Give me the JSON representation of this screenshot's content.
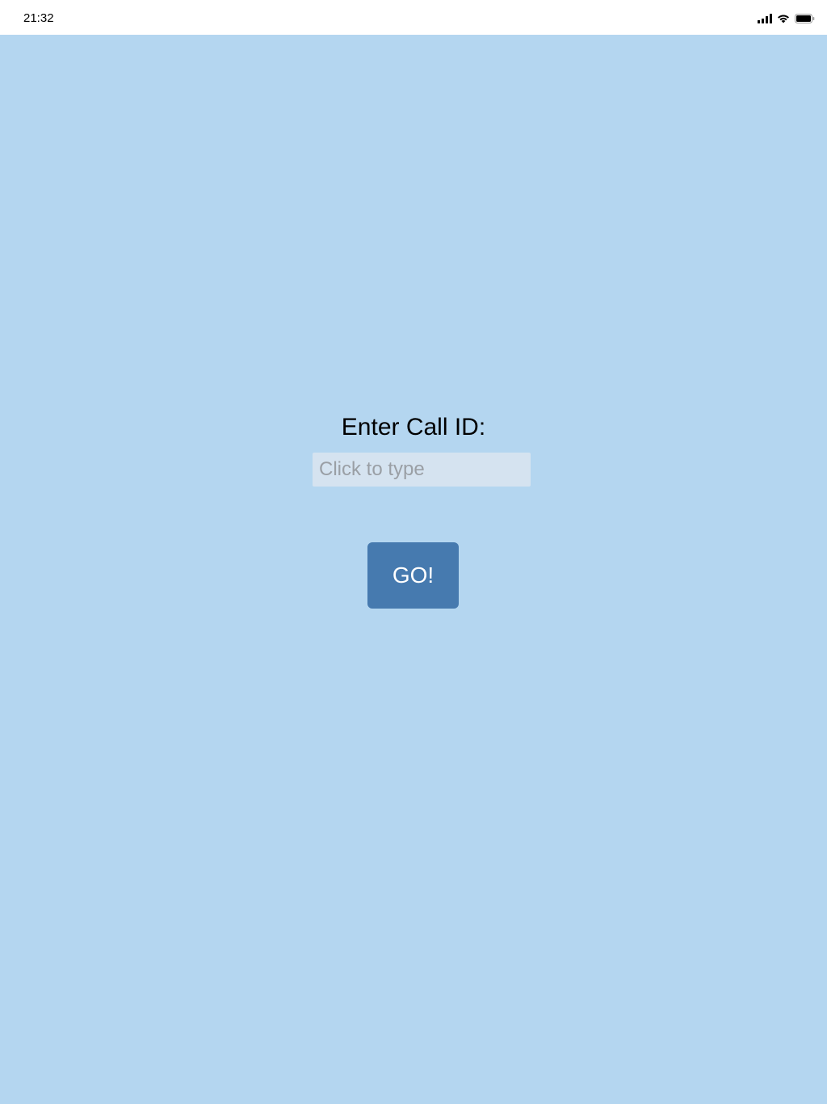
{
  "status_bar": {
    "time": "21:32",
    "icons": [
      "cellular-signal-icon",
      "wifi-icon",
      "battery-icon"
    ]
  },
  "form": {
    "label": "Enter Call ID:",
    "input_placeholder": "Click to type",
    "input_value": "",
    "go_label": "GO!"
  },
  "colors": {
    "background": "#b4d6f0",
    "input_background": "#d5e3f0",
    "button_background": "#467aaf",
    "button_text": "#ffffff"
  }
}
